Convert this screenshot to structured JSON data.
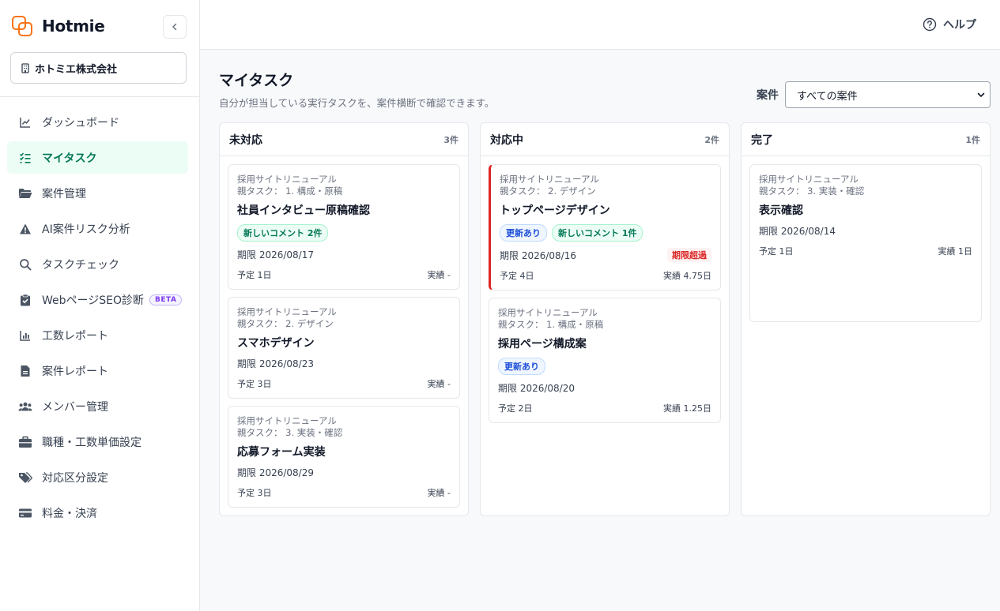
{
  "brand": {
    "name": "Hotmie"
  },
  "company": {
    "name": "ホトミエ株式会社"
  },
  "nav": [
    {
      "label": "ダッシュボード",
      "icon": "chart-line-icon"
    },
    {
      "label": "マイタスク",
      "icon": "task-list-icon",
      "active": true
    },
    {
      "label": "案件管理",
      "icon": "folder-icon"
    },
    {
      "label": "AI案件リスク分析",
      "icon": "warning-icon"
    },
    {
      "label": "タスクチェック",
      "icon": "search-icon"
    },
    {
      "label": "WebページSEO診断",
      "icon": "clipboard-check-icon",
      "badge": "BETA"
    },
    {
      "label": "工数レポート",
      "icon": "bar-chart-icon"
    },
    {
      "label": "案件レポート",
      "icon": "document-icon"
    },
    {
      "label": "メンバー管理",
      "icon": "users-icon"
    },
    {
      "label": "職種・工数単価設定",
      "icon": "briefcase-icon"
    },
    {
      "label": "対応区分設定",
      "icon": "tags-icon"
    },
    {
      "label": "料金・決済",
      "icon": "credit-card-icon"
    }
  ],
  "topbar": {
    "help_label": "ヘルプ"
  },
  "page": {
    "title": "マイタスク",
    "subtitle": "自分が担当している実行タスクを、案件横断で確認できます。",
    "filter_label": "案件",
    "filter_value": "すべての案件"
  },
  "columns": [
    {
      "title": "未対応",
      "count": "3件",
      "cards": [
        {
          "project": "採用サイトリニューアル",
          "parent": "親タスク： 1. 構成・原稿",
          "title": "社員インタビュー原稿確認",
          "badges": [
            {
              "type": "cmt",
              "text": "新しいコメント 2件"
            }
          ],
          "due": "期限 2026/08/17",
          "plan": "予定 1日",
          "actual": "実績 -"
        },
        {
          "project": "採用サイトリニューアル",
          "parent": "親タスク： 2. デザイン",
          "title": "スマホデザイン",
          "badges": [],
          "due": "期限 2026/08/23",
          "plan": "予定 3日",
          "actual": "実績 -"
        },
        {
          "project": "採用サイトリニューアル",
          "parent": "親タスク： 3. 実装・確認",
          "title": "応募フォーム実装",
          "badges": [],
          "due": "期限 2026/08/29",
          "plan": "予定 3日",
          "actual": "実績 -"
        }
      ]
    },
    {
      "title": "対応中",
      "count": "2件",
      "cards": [
        {
          "project": "採用サイトリニューアル",
          "parent": "親タスク： 2. デザイン",
          "title": "トップページデザイン",
          "badges": [
            {
              "type": "upd",
              "text": "更新あり"
            },
            {
              "type": "cmt",
              "text": "新しいコメント 1件"
            }
          ],
          "due": "期限 2026/08/16",
          "overdue": "期限超過",
          "plan": "予定 4日",
          "actual": "実績 4.75日"
        },
        {
          "project": "採用サイトリニューアル",
          "parent": "親タスク： 1. 構成・原稿",
          "title": "採用ページ構成案",
          "badges": [
            {
              "type": "upd",
              "text": "更新あり"
            }
          ],
          "due": "期限 2026/08/20",
          "plan": "予定 2日",
          "actual": "実績 1.25日"
        }
      ]
    },
    {
      "title": "完了",
      "count": "1件",
      "cards": [
        {
          "project": "採用サイトリニューアル",
          "parent": "親タスク： 3. 実装・確認",
          "title": "表示確認",
          "badges": [],
          "due": "期限 2026/08/14",
          "plan": "予定 1日",
          "actual": "実績 1日"
        }
      ]
    }
  ]
}
